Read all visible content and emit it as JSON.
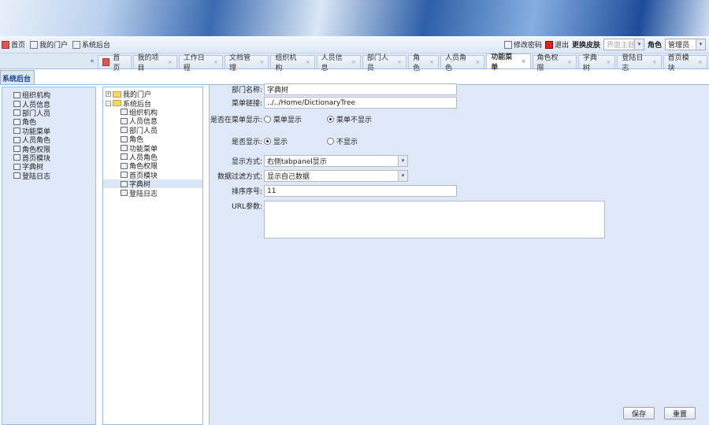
{
  "toolbar": {
    "left": [
      {
        "label": "首页",
        "icon": "home-icon"
      },
      {
        "label": "我的门户",
        "icon": "window-icon"
      },
      {
        "label": "系统后台",
        "icon": "window-icon"
      }
    ],
    "change_password": "修改密码",
    "logout": "退出",
    "skin_label": "更换皮肤",
    "skin_value": "界面主题",
    "role_label": "角色",
    "role_value": "管理员"
  },
  "tabs": {
    "collapse": "«",
    "home": "首页",
    "items": [
      "我的项目",
      "工作日程",
      "文档管理",
      "组织机构",
      "人员信息",
      "部门人员",
      "角色",
      "人员角色",
      "功能菜单",
      "角色权限",
      "字典树",
      "登陆日志",
      "首页模块"
    ],
    "active": "功能菜单",
    "close": "×"
  },
  "sidebar": {
    "title": "系统后台",
    "items": [
      "组织机构",
      "人员信息",
      "部门人员",
      "角色",
      "功能菜单",
      "人员角色",
      "角色权限",
      "首页模块",
      "字典树",
      "登陆日志"
    ]
  },
  "tree": {
    "roots": [
      {
        "label": "我的门户",
        "expander": "+"
      },
      {
        "label": "系统后台",
        "expander": "-"
      }
    ],
    "children": [
      "组织机构",
      "人员信息",
      "部门人员",
      "角色",
      "功能菜单",
      "人员角色",
      "角色权限",
      "首页模块",
      "字典树",
      "登陆日志"
    ],
    "selected": "字典树"
  },
  "form": {
    "name_label": "部门名称:",
    "name_value": "字典树",
    "link_label": "菜单链接:",
    "link_value": "../../Home/DictionaryTree",
    "menu_show_label": "是否在菜单显示:",
    "menu_show_opt1": "菜单显示",
    "menu_show_opt2": "菜单不显示",
    "visible_label": "是否显示:",
    "visible_opt1": "显示",
    "visible_opt2": "不显示",
    "display_mode_label": "显示方式:",
    "display_mode_value": "右侧tabpanel显示",
    "filter_label": "数据过滤方式:",
    "filter_value": "显示自己数据",
    "order_label": "排序序号:",
    "order_value": "11",
    "url_label": "URL参数:",
    "url_value": ""
  },
  "buttons": {
    "save": "保存",
    "reset": "重置"
  }
}
